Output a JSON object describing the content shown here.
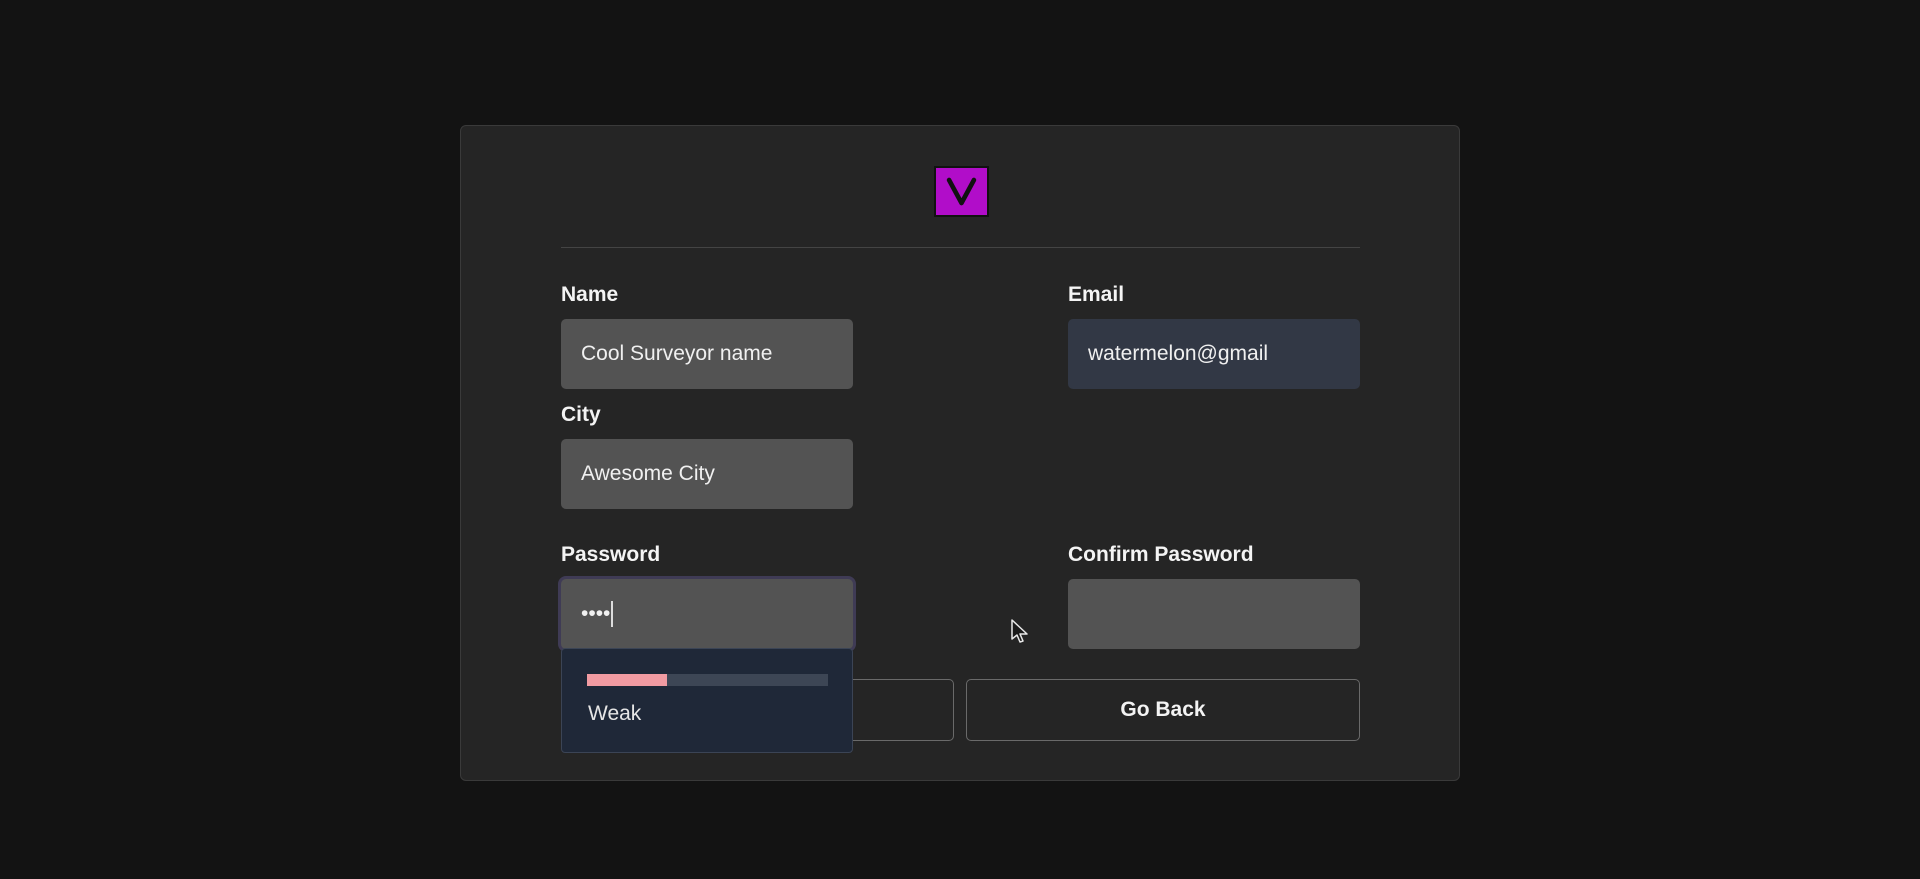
{
  "form": {
    "name_label": "Name",
    "name_value": "Cool Surveyor name",
    "email_label": "Email",
    "email_value": "watermelon@gmail",
    "city_label": "City",
    "city_value": "Awesome City",
    "password_label": "Password",
    "password_value": "••••",
    "confirm_label": "Confirm Password",
    "confirm_value": ""
  },
  "buttons": {
    "submit_label": "",
    "back_label": "Go Back"
  },
  "password_strength": {
    "label": "Weak",
    "level": 0.33,
    "color": "#f19ba2"
  },
  "colors": {
    "background": "#131313",
    "card": "#252525",
    "logo": "#b10dc9",
    "input": "#535353",
    "email_input": "#323845"
  },
  "icons": {
    "logo": "v-logo-icon",
    "cursor": "mouse-pointer-icon"
  }
}
